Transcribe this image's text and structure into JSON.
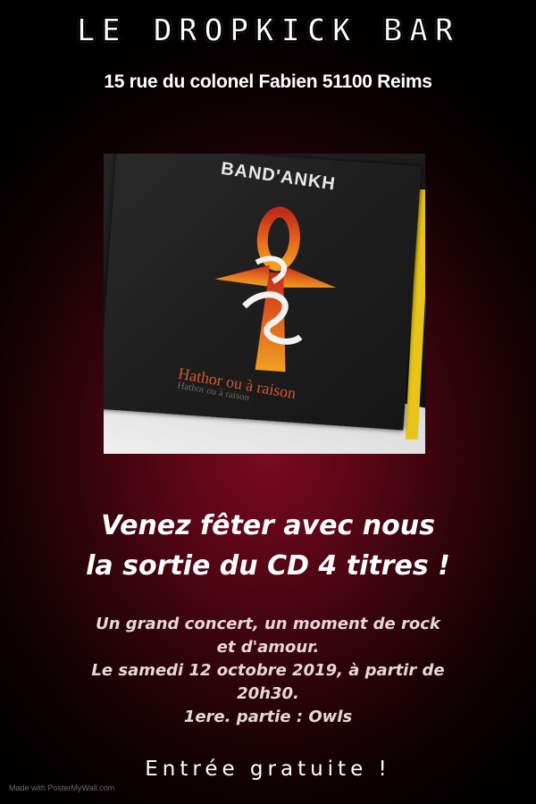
{
  "poster": {
    "venue_title": "LE DROPKICK BAR",
    "address": "15 rue du colonel Fabien 51100 Reims",
    "headline_line1": "Venez fêter avec nous",
    "headline_line2": "la sortie du CD 4 titres !",
    "details_lines": [
      "Un grand concert, un moment de rock",
      "et d'amour.",
      "Le samedi 12 octobre 2019, à partir de",
      "20h30.",
      "1ere. partie : Owls"
    ],
    "entry": "Entrée gratuite !",
    "watermark": "Made with PosterMyWall.com"
  },
  "photo": {
    "band_name": "BAND'ANKH",
    "album_title": "Hathor ou à raison",
    "album_title_reflection": "Hathor ou à raison"
  },
  "colors": {
    "background_center": "#7a0a1f",
    "background_edge": "#000000",
    "ankh_orange": "#e2651e",
    "ankh_red": "#b3201a"
  }
}
